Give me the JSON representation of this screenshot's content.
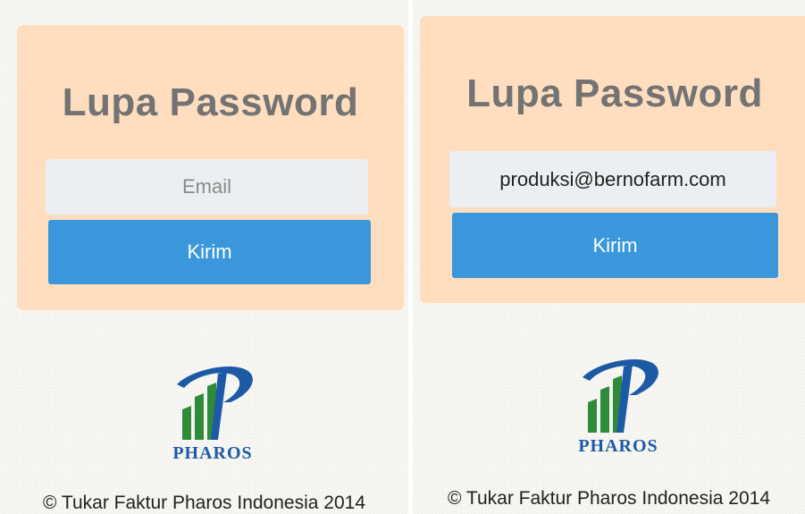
{
  "left_screen": {
    "title": "Lupa Password",
    "email_input": {
      "value": "",
      "placeholder": "Email"
    },
    "send_button_label": "Kirim",
    "logo_text": "PHAROS",
    "footer": "© Tukar Faktur Pharos Indonesia 2014"
  },
  "right_screen": {
    "title": "Lupa Password",
    "email_input": {
      "value": "produksi@bernofarm.com",
      "placeholder": "Email"
    },
    "send_button_label": "Kirim",
    "logo_text": "PHAROS",
    "footer": "© Tukar Faktur Pharos Indonesia 2014"
  },
  "colors": {
    "card_background": "#ffdec0",
    "button": "#3a97dc",
    "title_text": "#737373",
    "logo_blue": "#1d5aa6",
    "logo_green": "#2e8b3a"
  },
  "icons": [
    "pharos-logo-icon"
  ]
}
